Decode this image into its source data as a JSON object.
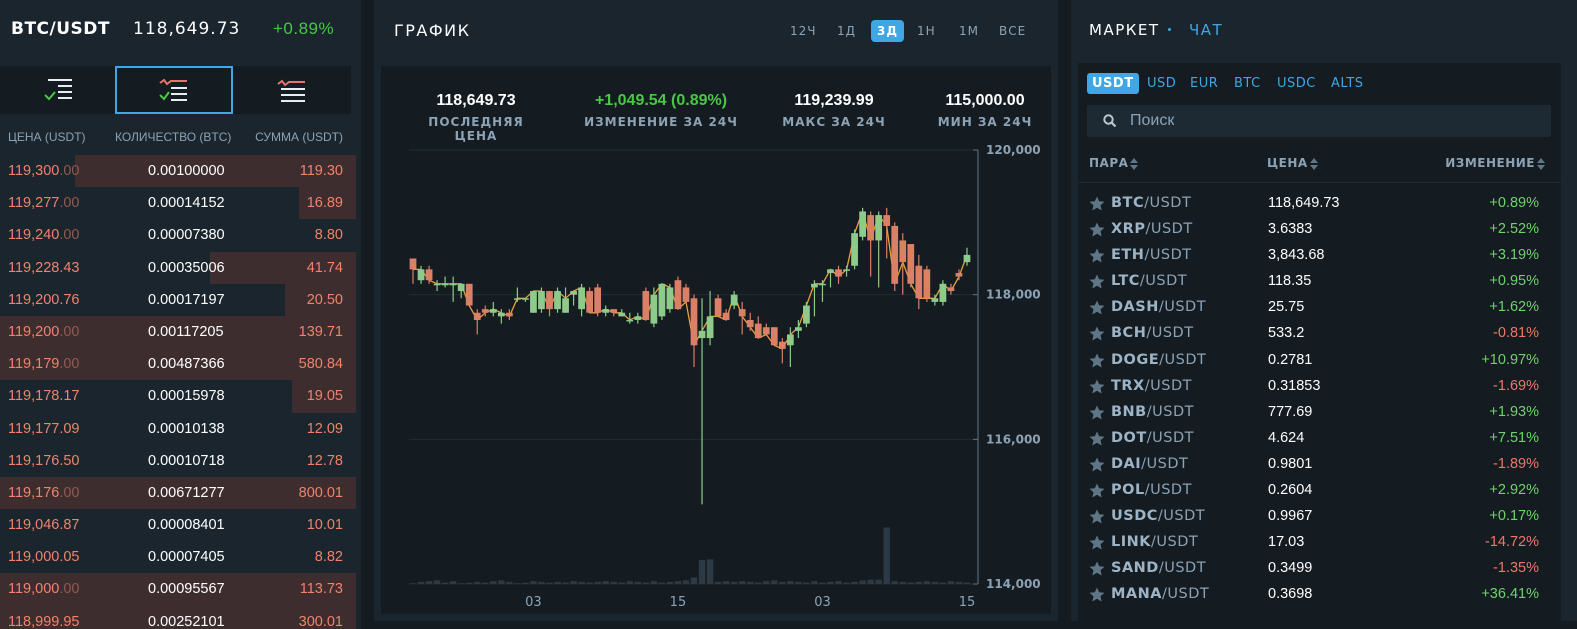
{
  "header": {
    "pair": "BTC/USDT",
    "price": "118,649.73",
    "change": "+0.89%"
  },
  "orderbook": {
    "view_tabs": [
      "both-books-icon",
      "bids-book-icon",
      "asks-book-icon"
    ],
    "columns": {
      "price": "ЦЕНА (USDT)",
      "qty": "КОЛИЧЕСТВО (BTC)",
      "sum": "СУММА (USDT)"
    },
    "rows": [
      {
        "price_main": "119,300",
        "price_dim": ".00",
        "qty": "0.00100000",
        "sum": "119.30",
        "depth": 0.79
      },
      {
        "price_main": "119,277",
        "price_dim": ".00",
        "qty": "0.00014152",
        "sum": "16.89",
        "depth": 0.16
      },
      {
        "price_main": "119,240",
        "price_dim": ".00",
        "qty": "0.00007380",
        "sum": "8.80",
        "depth": 0.0
      },
      {
        "price_main": "119,228.43",
        "price_dim": "",
        "qty": "0.00035006",
        "sum": "41.74",
        "depth": 0.41
      },
      {
        "price_main": "119,200.76",
        "price_dim": "",
        "qty": "0.00017197",
        "sum": "20.50",
        "depth": 0.2
      },
      {
        "price_main": "119,200",
        "price_dim": ".00",
        "qty": "0.00117205",
        "sum": "139.71",
        "depth": 1.0
      },
      {
        "price_main": "119,179",
        "price_dim": ".00",
        "qty": "0.00487366",
        "sum": "580.84",
        "depth": 1.0
      },
      {
        "price_main": "119,178.17",
        "price_dim": "",
        "qty": "0.00015978",
        "sum": "19.05",
        "depth": 0.18
      },
      {
        "price_main": "119,177.09",
        "price_dim": "",
        "qty": "0.00010138",
        "sum": "12.09",
        "depth": 0.0
      },
      {
        "price_main": "119,176.50",
        "price_dim": "",
        "qty": "0.00010718",
        "sum": "12.78",
        "depth": 0.0
      },
      {
        "price_main": "119,176",
        "price_dim": ".00",
        "qty": "0.00671277",
        "sum": "800.01",
        "depth": 1.0
      },
      {
        "price_main": "119,046.87",
        "price_dim": "",
        "qty": "0.00008401",
        "sum": "10.01",
        "depth": 0.0
      },
      {
        "price_main": "119,000.05",
        "price_dim": "",
        "qty": "0.00007405",
        "sum": "8.82",
        "depth": 0.0
      },
      {
        "price_main": "119,000",
        "price_dim": ".00",
        "qty": "0.00095567",
        "sum": "113.73",
        "depth": 1.0
      },
      {
        "price_main": "118,999.95",
        "price_dim": "",
        "qty": "0.00252101",
        "sum": "300.01",
        "depth": 1.0
      }
    ]
  },
  "chart_panel": {
    "title": "ГРАФИК",
    "timeframes": [
      "12Ч",
      "1Д",
      "3Д",
      "1Н",
      "1М",
      "ВСЕ"
    ],
    "active_timeframe": "3Д",
    "stats": [
      {
        "value": "118,649.73",
        "label": "ПОСЛЕДНЯЯ ЦЕНА",
        "color": "white"
      },
      {
        "value": "+1,049.54 (0.89%)",
        "label": "ИЗМЕНЕНИЕ ЗА 24Ч",
        "color": "green"
      },
      {
        "value": "119,239.99",
        "label": "МАКС ЗА 24Ч",
        "color": "white"
      },
      {
        "value": "115,000.00",
        "label": "МИН ЗА 24Ч",
        "color": "white"
      }
    ]
  },
  "chart_data": {
    "type": "candlestick",
    "ylim": [
      114000,
      120000
    ],
    "yticks": [
      "120,000",
      "118,000",
      "116,000",
      "114,000"
    ],
    "ytick_values": [
      120000,
      118000,
      116000,
      114000
    ],
    "xticks": [
      "03",
      "15",
      "03",
      "15"
    ],
    "xtick_index": [
      15,
      33,
      51,
      69
    ],
    "up_color": "#8ecb8a",
    "down_color": "#d98067",
    "line_color": "#e8a23a",
    "candles": [
      [
        118500,
        118350,
        118500,
        118150
      ],
      [
        118200,
        118350,
        118400,
        118150
      ],
      [
        118350,
        118200,
        118400,
        118150
      ],
      [
        118150,
        118150,
        118200,
        118050
      ],
      [
        118150,
        118150,
        118250,
        118100
      ],
      [
        118150,
        118150,
        118250,
        117900
      ],
      [
        118050,
        118150,
        118150,
        117950
      ],
      [
        118150,
        117850,
        118150,
        117850
      ],
      [
        117750,
        117650,
        117800,
        117450
      ],
      [
        117800,
        117750,
        117850,
        117700
      ],
      [
        117750,
        117800,
        117900,
        117700
      ],
      [
        117700,
        117750,
        117800,
        117600
      ],
      [
        117750,
        117700,
        117800,
        117650
      ],
      [
        117950,
        117950,
        118100,
        117900
      ],
      [
        117950,
        117950,
        117950,
        117900
      ],
      [
        117750,
        118050,
        118050,
        117750
      ],
      [
        117800,
        118050,
        118100,
        117750
      ],
      [
        118050,
        117800,
        118050,
        117700
      ],
      [
        117800,
        118050,
        118100,
        117750
      ],
      [
        117750,
        117950,
        118100,
        117750
      ],
      [
        118000,
        118050,
        118050,
        117850
      ],
      [
        117800,
        118100,
        118150,
        117700
      ],
      [
        118050,
        117750,
        118100,
        117750
      ],
      [
        118100,
        117750,
        118150,
        117700
      ],
      [
        117750,
        117800,
        117850,
        117700
      ],
      [
        117800,
        117750,
        117800,
        117700
      ],
      [
        117700,
        117750,
        117800,
        117700
      ],
      [
        117650,
        117650,
        117750,
        117600
      ],
      [
        117650,
        117700,
        117750,
        117600
      ],
      [
        118050,
        117650,
        118100,
        117650
      ],
      [
        117600,
        118000,
        118100,
        117550
      ],
      [
        117700,
        118150,
        118150,
        117650
      ],
      [
        117800,
        118100,
        118150,
        117750
      ],
      [
        118200,
        117800,
        118250,
        117800
      ],
      [
        118100,
        117900,
        118150,
        117900
      ],
      [
        117950,
        117300,
        118000,
        117000
      ],
      [
        117400,
        117500,
        117950,
        115100
      ],
      [
        117400,
        117700,
        118050,
        117300
      ],
      [
        117950,
        117700,
        118000,
        117700
      ],
      [
        117750,
        117650,
        117800,
        117650
      ],
      [
        117850,
        118000,
        118050,
        117800
      ],
      [
        117800,
        117700,
        117900,
        117450
      ],
      [
        117650,
        117550,
        117750,
        117500
      ],
      [
        117600,
        117400,
        117700,
        117400
      ],
      [
        117550,
        117450,
        117600,
        117450
      ],
      [
        117550,
        117300,
        117550,
        117300
      ],
      [
        117350,
        117250,
        117400,
        117050
      ],
      [
        117300,
        117450,
        117550,
        117000
      ],
      [
        117500,
        117550,
        117650,
        117400
      ],
      [
        117600,
        117850,
        117900,
        117550
      ],
      [
        118100,
        118150,
        118200,
        117700
      ],
      [
        118150,
        118150,
        118200,
        117900
      ],
      [
        118300,
        118350,
        118350,
        118100
      ],
      [
        118350,
        118250,
        118400,
        118150
      ],
      [
        118350,
        118350,
        118400,
        118250
      ],
      [
        118400,
        118850,
        118900,
        118350
      ],
      [
        118800,
        119150,
        119200,
        118750
      ],
      [
        119100,
        118750,
        119150,
        118250
      ],
      [
        118750,
        119100,
        119150,
        118100
      ],
      [
        119100,
        118950,
        119200,
        118500
      ],
      [
        118950,
        118150,
        119000,
        118050
      ],
      [
        118750,
        118450,
        118850,
        118000
      ],
      [
        118700,
        118150,
        118700,
        118100
      ],
      [
        118400,
        117950,
        118550,
        117800
      ],
      [
        118350,
        117950,
        118400,
        117900
      ],
      [
        117900,
        117950,
        118000,
        117850
      ],
      [
        117900,
        118150,
        118200,
        117850
      ],
      [
        118100,
        118050,
        118150,
        118000
      ],
      [
        118300,
        118250,
        118350,
        118200
      ],
      [
        118450,
        118550,
        118650,
        118400
      ]
    ],
    "volumes": [
      0.1,
      0.3,
      0.4,
      0.5,
      0.2,
      0.4,
      0.1,
      0.2,
      0.3,
      0.2,
      0.4,
      0.5,
      0.3,
      0.1,
      0.2,
      0.4,
      0.3,
      0.2,
      0.3,
      0.2,
      0.4,
      0.3,
      0.2,
      0.3,
      0.4,
      0.3,
      0.2,
      0.4,
      0.3,
      0.2,
      0.4,
      0.2,
      0.3,
      0.4,
      0.5,
      0.9,
      3.3,
      3.4,
      0.3,
      0.4,
      0.3,
      0.4,
      0.3,
      0.2,
      0.4,
      0.5,
      0.3,
      0.4,
      0.3,
      0.2,
      0.4,
      0.2,
      0.3,
      0.4,
      0.2,
      0.3,
      0.5,
      0.6,
      0.6,
      7.8,
      0.4,
      0.3,
      0.2,
      0.3,
      0.4,
      0.3,
      0.2,
      0.4,
      0.3,
      0.2
    ]
  },
  "market": {
    "tabs": [
      "МАРКЕТ",
      "ЧАТ"
    ],
    "currencies": [
      "USDT",
      "USD",
      "EUR",
      "BTC",
      "USDC",
      "ALTS"
    ],
    "active_currency": "USDT",
    "search_placeholder": "Поиск",
    "columns": {
      "pair": "ПАРА",
      "price": "ЦЕНА",
      "change": "ИЗМЕНЕНИЕ"
    },
    "rows": [
      {
        "base": "BTC",
        "quote": "/USDT",
        "price": "118,649.73",
        "change": "+0.89%",
        "dir": "up"
      },
      {
        "base": "XRP",
        "quote": "/USDT",
        "price": "3.6383",
        "change": "+2.52%",
        "dir": "up"
      },
      {
        "base": "ETH",
        "quote": "/USDT",
        "price": "3,843.68",
        "change": "+3.19%",
        "dir": "up"
      },
      {
        "base": "LTC",
        "quote": "/USDT",
        "price": "118.35",
        "change": "+0.95%",
        "dir": "up"
      },
      {
        "base": "DASH",
        "quote": "/USDT",
        "price": "25.75",
        "change": "+1.62%",
        "dir": "up"
      },
      {
        "base": "BCH",
        "quote": "/USDT",
        "price": "533.2",
        "change": "-0.81%",
        "dir": "down"
      },
      {
        "base": "DOGE",
        "quote": "/USDT",
        "price": "0.2781",
        "change": "+10.97%",
        "dir": "up"
      },
      {
        "base": "TRX",
        "quote": "/USDT",
        "price": "0.31853",
        "change": "-1.69%",
        "dir": "down"
      },
      {
        "base": "BNB",
        "quote": "/USDT",
        "price": "777.69",
        "change": "+1.93%",
        "dir": "up"
      },
      {
        "base": "DOT",
        "quote": "/USDT",
        "price": "4.624",
        "change": "+7.51%",
        "dir": "up"
      },
      {
        "base": "DAI",
        "quote": "/USDT",
        "price": "0.9801",
        "change": "-1.89%",
        "dir": "down"
      },
      {
        "base": "POL",
        "quote": "/USDT",
        "price": "0.2604",
        "change": "+2.92%",
        "dir": "up"
      },
      {
        "base": "USDC",
        "quote": "/USDT",
        "price": "0.9967",
        "change": "+0.17%",
        "dir": "up"
      },
      {
        "base": "LINK",
        "quote": "/USDT",
        "price": "17.03",
        "change": "-14.72%",
        "dir": "down"
      },
      {
        "base": "SAND",
        "quote": "/USDT",
        "price": "0.3499",
        "change": "-1.35%",
        "dir": "down"
      },
      {
        "base": "MANA",
        "quote": "/USDT",
        "price": "0.3698",
        "change": "+36.41%",
        "dir": "up"
      }
    ]
  }
}
